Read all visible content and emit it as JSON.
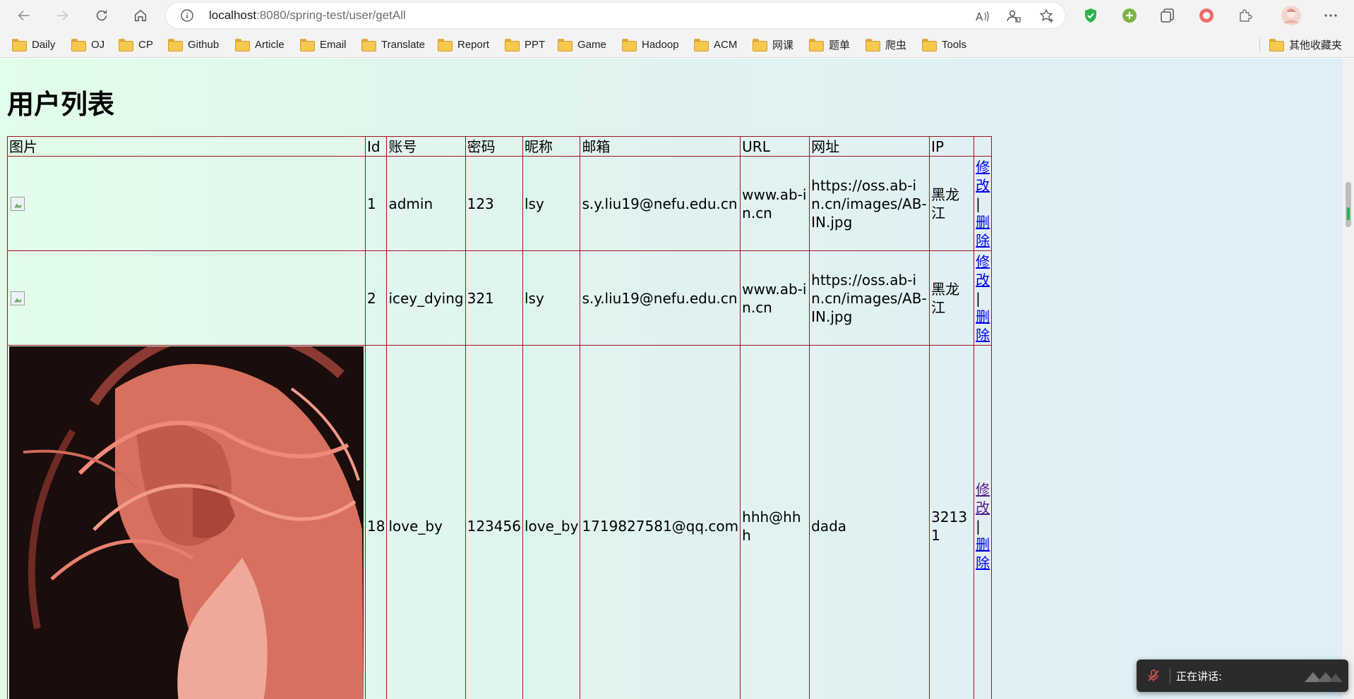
{
  "browser": {
    "url_host": "localhost",
    "url_rest": ":8080/spring-test/user/getAll",
    "bookmarks": [
      "Daily",
      "OJ",
      "CP",
      "Github",
      "Article",
      "Email",
      "Translate",
      "Report",
      "PPT",
      "Game",
      "Hadoop",
      "ACM",
      "网课",
      "题单",
      "爬虫",
      "Tools"
    ],
    "other_bookmarks": "其他收藏夹"
  },
  "page": {
    "title": "用户列表",
    "columns": [
      "图片",
      "Id",
      "账号",
      "密码",
      "昵称",
      "邮箱",
      "URL",
      "网址",
      "IP",
      ""
    ],
    "rows": [
      {
        "id": "1",
        "account": "admin",
        "password": "123",
        "nickname": "lsy",
        "email": "s.y.liu19@nefu.edu.cn",
        "url": "www.ab-in.cn",
        "website": "https://oss.ab-in.cn/images/AB-IN.jpg",
        "ip": "黑龙江",
        "image": "broken"
      },
      {
        "id": "2",
        "account": "icey_dying",
        "password": "321",
        "nickname": "lsy",
        "email": "s.y.liu19@nefu.edu.cn",
        "url": "www.ab-in.cn",
        "website": "https://oss.ab-in.cn/images/AB-IN.jpg",
        "ip": "黑龙江",
        "image": "broken"
      },
      {
        "id": "18",
        "account": "love_by",
        "password": "123456",
        "nickname": "love_by",
        "email": "1719827581@qq.com",
        "url": "hhh@hhh",
        "website": "dada",
        "ip": "32131",
        "image": "avatar-illustration"
      }
    ],
    "action_edit": "修改",
    "action_sep": "|",
    "action_delete": "删除"
  },
  "voice_overlay": {
    "text": "正在讲话:"
  },
  "colors": {
    "table_border": "#a0141e",
    "link": "#0000ee",
    "visited_link": "#551a8b",
    "bg_left": "#e2fde9",
    "bg_right": "#e0eef8"
  }
}
